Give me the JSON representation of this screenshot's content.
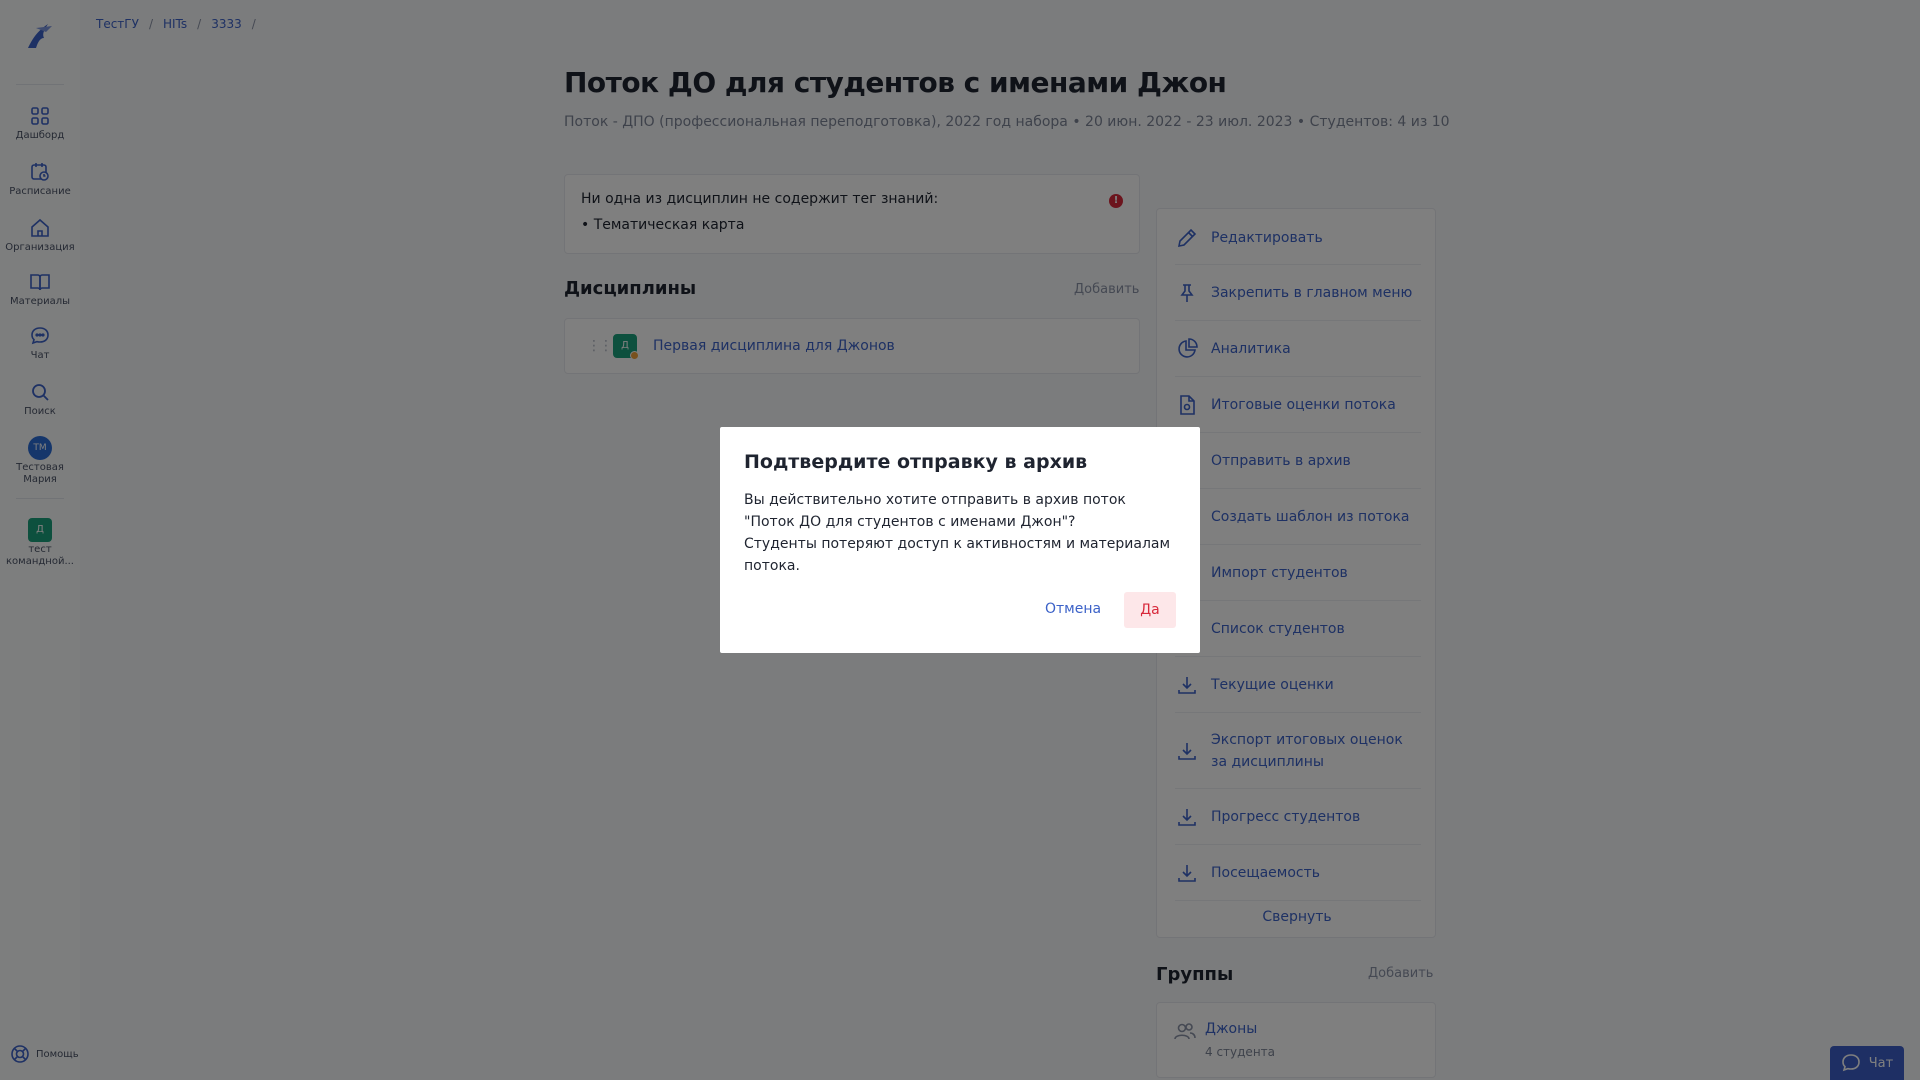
{
  "colors": {
    "accent": "#3c62c8",
    "danger": "#d8293b",
    "overlay": "rgba(0,0,0,0.5)",
    "success": "#1ba07c"
  },
  "sidebar": {
    "items": [
      {
        "label": "Дашборд",
        "icon": "dashboard-grid-icon"
      },
      {
        "label": "Расписание",
        "icon": "calendar-clock-icon"
      },
      {
        "label": "Организация",
        "icon": "home-icon"
      },
      {
        "label": "Материалы",
        "icon": "book-icon"
      },
      {
        "label": "Чат",
        "icon": "chat-bubble-icon"
      },
      {
        "label": "Поиск",
        "icon": "search-icon"
      }
    ],
    "user": {
      "initials": "ТМ",
      "name_line1": "Тестовая",
      "name_line2": "Мария"
    },
    "team": {
      "initial": "Д",
      "name_line1": "тест",
      "name_line2": "командной..."
    },
    "help": "Помощь"
  },
  "breadcrumb": [
    "ТестГУ",
    "HITs",
    "3333"
  ],
  "page": {
    "title": "Поток ДО для студентов с именами Джон",
    "subtitle": "Поток - ДПО (профессиональная переподготовка), 2022 год набора • 20 июн. 2022 - 23 июл. 2023 • Студентов: 4 из 10"
  },
  "warning": {
    "text": "Ни одна из дисциплин не содержит тег знаний:",
    "item": "• Тематическая карта",
    "badge": "!"
  },
  "disciplines": {
    "title": "Дисциплины",
    "add": "Добавить",
    "items": [
      {
        "initial": "Д",
        "name": "Первая дисциплина для Джонов"
      }
    ]
  },
  "actions": {
    "items": [
      {
        "label": "Редактировать",
        "icon": "pencil-icon"
      },
      {
        "label": "Закрепить в главном меню",
        "icon": "pin-icon"
      },
      {
        "label": "Аналитика",
        "icon": "pie-chart-icon"
      },
      {
        "label": "Итоговые оценки потока",
        "icon": "document-icon"
      },
      {
        "label": "Отправить в архив",
        "icon": "archive-icon"
      },
      {
        "label": "Создать шаблон из потока",
        "icon": "template-icon"
      },
      {
        "label": "Импорт студентов",
        "icon": "import-icon"
      },
      {
        "label": "Список студентов",
        "icon": "list-icon"
      },
      {
        "label": "Текущие оценки",
        "icon": "download-icon"
      },
      {
        "label": "Экспорт итоговых оценок за дисциплины",
        "icon": "download-icon"
      },
      {
        "label": "Прогресс студентов",
        "icon": "download-icon"
      },
      {
        "label": "Посещаемость",
        "icon": "download-icon"
      }
    ],
    "collapse": "Свернуть"
  },
  "groups": {
    "title": "Группы",
    "add": "Добавить",
    "items": [
      {
        "name": "Джоны",
        "count": "4 студента"
      }
    ]
  },
  "modal": {
    "title": "Подтвердите отправку в архив",
    "body_line1": "Вы действительно хотите отправить в архив поток \"Поток ДО для студентов с именами Джон\"?",
    "body_line2": "Студенты потеряют доступ к активностям и материалам потока.",
    "cancel": "Отмена",
    "confirm": "Да"
  },
  "chat_button": "Чат"
}
